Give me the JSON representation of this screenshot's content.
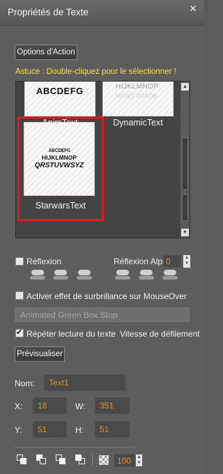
{
  "window": {
    "title": "Propriétés de Texte",
    "close_icon": "x"
  },
  "action_button": "Options d'Action",
  "tip": "Astuce : Double-cliquez pour le sélectionner !",
  "gallery": {
    "items": [
      {
        "label": "AnimText",
        "sample": "ABCDEFG"
      },
      {
        "label": "DynamicText",
        "sample": "HIJKLMNOP"
      },
      {
        "label": "StarwarsText",
        "sample_lines": [
          "ABCDEFG",
          "HIJKLMNOP",
          "QRSTUVWSYZ"
        ],
        "selected": true
      }
    ]
  },
  "reflection": {
    "checkbox_label": "Réflexion",
    "alpha_label": "Réflexion Alpha:",
    "alpha_value": "0"
  },
  "mouseover": {
    "checkbox_label": "Activer effet de surbrillance sur MouseOver",
    "sound_value": "Animated Green Box Stop"
  },
  "repeat": {
    "checkbox_label": "Répéter lecture du texte",
    "speed_label": "Vitesse de défilement"
  },
  "preview_button": "Prévisualiser",
  "properties": {
    "name_label": "Nom:",
    "name_value": "Text1",
    "x_label": "X:",
    "x_value": "18",
    "w_label": "W:",
    "w_value": "351",
    "y_label": "Y:",
    "y_value": "51",
    "h_label": "H:",
    "h_value": "51"
  },
  "footer": {
    "opacity_value": "100"
  },
  "colors": {
    "highlight_text": "#f5e23a",
    "value_text": "#e58b1e",
    "selection_border": "#e01a1a"
  }
}
